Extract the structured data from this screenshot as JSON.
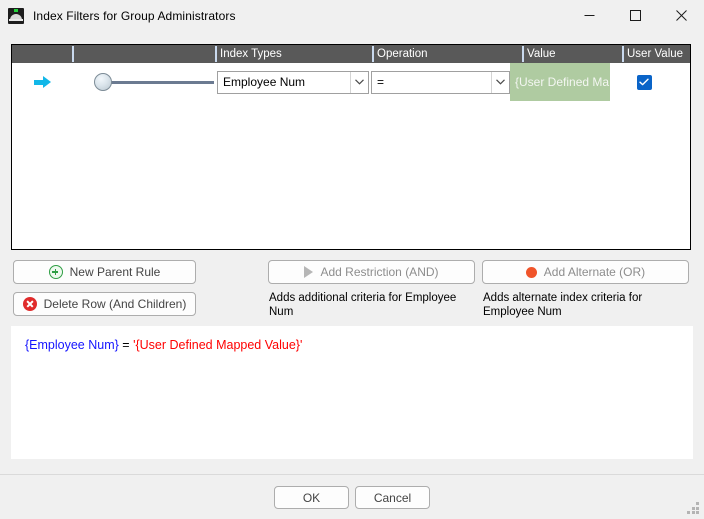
{
  "window": {
    "title": "Index Filters for Group Administrators",
    "icon": "app-icon",
    "controls": {
      "minimize": "minimize-icon",
      "maximize": "maximize-icon",
      "close": "close-icon"
    }
  },
  "grid": {
    "columns": [
      {
        "id": "arrow",
        "label": ""
      },
      {
        "id": "tree",
        "label": ""
      },
      {
        "id": "index_types",
        "label": "Index Types"
      },
      {
        "id": "operation",
        "label": "Operation"
      },
      {
        "id": "value",
        "label": "Value"
      },
      {
        "id": "user_value",
        "label": "User Value"
      }
    ],
    "rows": [
      {
        "row_indicator": "current-row-arrow",
        "index_type": "Employee Num",
        "operation": "=",
        "value": "{User Defined Ma...",
        "user_value_checked": true
      }
    ]
  },
  "actions": {
    "new_parent_rule": "New Parent Rule",
    "delete_row": "Delete Row (And Children)",
    "add_restriction": "Add Restriction (AND)",
    "add_alternate": "Add Alternate (OR)",
    "helper_and": "Adds additional criteria for Employee Num",
    "helper_or": "Adds alternate index criteria for Employee Num"
  },
  "expression": {
    "field": "{Employee Num}",
    "operator": "=",
    "value": "'{User Defined Mapped Value}'"
  },
  "footer": {
    "ok": "OK",
    "cancel": "Cancel"
  },
  "colors": {
    "header_bg": "#595959",
    "value_cell_bg": "#afcba1",
    "checkbox": "#0a64c8",
    "row_arrow": "#11b7e8",
    "expr_field": "#1515ff",
    "expr_value": "#ff0000",
    "icon_add": "#2f9e44",
    "icon_delete": "#e02b2b",
    "icon_or": "#f0542a"
  }
}
